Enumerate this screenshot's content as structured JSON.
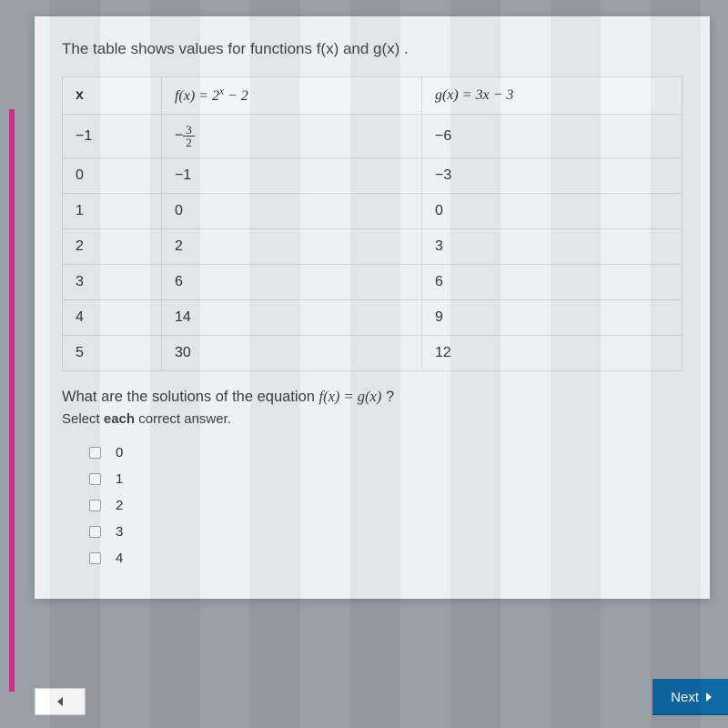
{
  "prompt": "The table shows values for functions f(x) and g(x) .",
  "table": {
    "headers": {
      "x": "x",
      "f_label_prefix": "f(x) = 2",
      "f_label_exp": "x",
      "f_label_suffix": " − 2",
      "g_label": "g(x) = 3x − 3"
    },
    "rows": [
      {
        "x": "−1",
        "f": "−",
        "f_frac_n": "3",
        "f_frac_d": "2",
        "g": "−6"
      },
      {
        "x": "0",
        "f": "−1",
        "g": "−3"
      },
      {
        "x": "1",
        "f": "0",
        "g": "0"
      },
      {
        "x": "2",
        "f": "2",
        "g": "3"
      },
      {
        "x": "3",
        "f": "6",
        "g": "6"
      },
      {
        "x": "4",
        "f": "14",
        "g": "9"
      },
      {
        "x": "5",
        "f": "30",
        "g": "12"
      }
    ]
  },
  "question2_prefix": "What are the solutions of the equation ",
  "question2_eq": "f(x) = g(x)",
  "question2_suffix": " ?",
  "instruction_prefix": "Select ",
  "instruction_bold": "each",
  "instruction_suffix": " correct answer.",
  "choices": [
    "0",
    "1",
    "2",
    "3",
    "4"
  ],
  "nav": {
    "next": "Next"
  }
}
